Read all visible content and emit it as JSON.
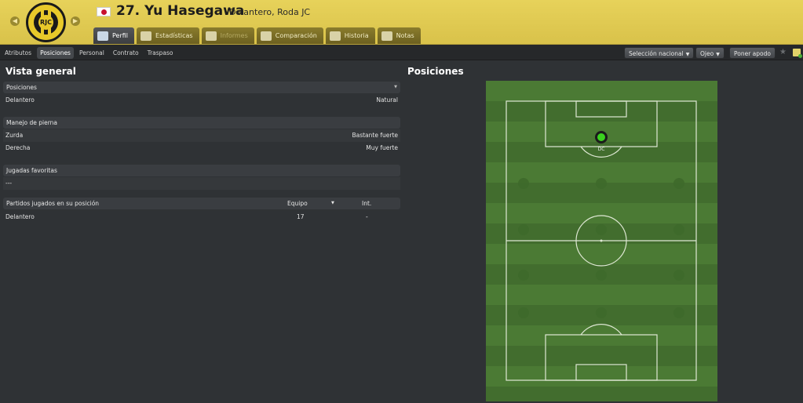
{
  "header": {
    "player_number_name": "27. Yu Hasegawa",
    "player_subtitle": "Delantero, Roda JC",
    "crest_text": "RJC",
    "tabs": [
      {
        "label": "Perfil",
        "icon": "profile-icon",
        "active": true
      },
      {
        "label": "Estadísticas",
        "icon": "stats-icon"
      },
      {
        "label": "Informes",
        "icon": "reports-icon",
        "disabled": true
      },
      {
        "label": "Comparación",
        "icon": "compare-icon"
      },
      {
        "label": "Historia",
        "icon": "history-icon"
      },
      {
        "label": "Notas",
        "icon": "notes-icon"
      }
    ]
  },
  "subnav": {
    "tabs": [
      "Atributos",
      "Posiciones",
      "Personal",
      "Contrato",
      "Traspaso"
    ],
    "active": "Posiciones",
    "buttons": {
      "national": "Selección nacional",
      "scout": "Ojeo",
      "nickname": "Poner apodo"
    }
  },
  "left": {
    "title": "Vista general",
    "positions": {
      "header": "Posiciones",
      "rows": [
        {
          "label": "Delantero",
          "value": "Natural"
        }
      ]
    },
    "footedness": {
      "header": "Manejo de pierna",
      "rows": [
        {
          "label": "Zurda",
          "value": "Bastante fuerte"
        },
        {
          "label": "Derecha",
          "value": "Muy fuerte"
        }
      ]
    },
    "favourite_moves": {
      "header": "Jugadas favoritas",
      "value": "---"
    },
    "games_played": {
      "header": "Partidos jugados en su posición",
      "col_team": "Equipo",
      "col_int": "Int.",
      "rows": [
        {
          "label": "Delantero",
          "team": "17",
          "int": "-"
        }
      ]
    }
  },
  "right": {
    "title": "Posiciones",
    "position_marker_label": "DC",
    "marker_color": "#3ad11f"
  }
}
